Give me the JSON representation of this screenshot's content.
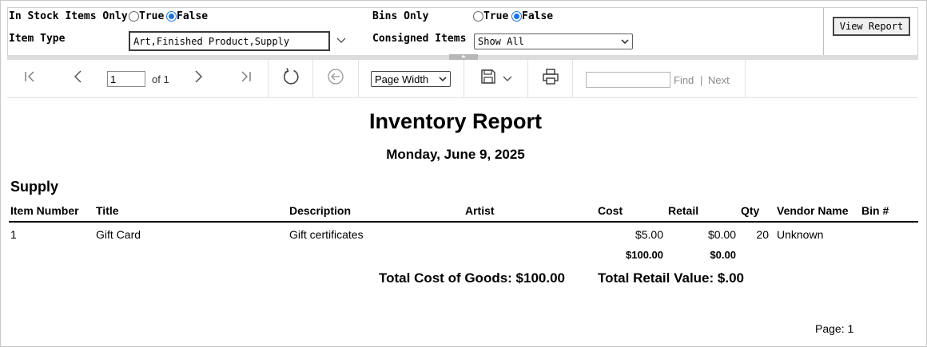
{
  "params": {
    "in_stock": {
      "label": "In Stock Items Only",
      "true_label": "True",
      "false_label": "False",
      "selected": "False"
    },
    "bins_only": {
      "label": "Bins Only",
      "true_label": "True",
      "false_label": "False",
      "selected": "False"
    },
    "item_type": {
      "label": "Item Type",
      "value": "Art,Finished Product,Supply"
    },
    "consigned": {
      "label": "Consigned Items",
      "value": "Show All"
    },
    "view_report_label": "View Report"
  },
  "toolbar": {
    "page_value": "1",
    "of_label": "of 1",
    "zoom": "Page Width",
    "find_label": "Find",
    "find_sep": "|",
    "next_label": "Next",
    "icons": [
      "first-page-icon",
      "previous-page-icon",
      "next-page-icon",
      "last-page-icon",
      "refresh-icon",
      "back-icon",
      "save-icon",
      "chevron-down-icon",
      "print-icon"
    ]
  },
  "report": {
    "title": "Inventory Report",
    "date": "Monday, June 9, 2025",
    "section": "Supply",
    "columns": [
      "Item Number",
      "Title",
      "Description",
      "Artist",
      "Cost",
      "Retail",
      "Qty",
      "Vendor Name",
      "Bin #"
    ],
    "rows": [
      {
        "item_number": "1",
        "title": "Gift Card",
        "description": "Gift certificates",
        "artist": "",
        "cost": "$5.00",
        "retail": "$0.00",
        "qty": "20",
        "vendor": "Unknown",
        "bin": ""
      }
    ],
    "subtotal": {
      "cost": "$100.00",
      "retail": "$0.00"
    },
    "total_cost": "Total Cost of Goods: $100.00",
    "total_retail": "Total Retail Value: $.00",
    "page_label": "Page: 1"
  },
  "colors": {
    "radio_accent": "#1a73e8",
    "toolbar_icon": "#555555",
    "find_link": "#8c8c8c"
  }
}
